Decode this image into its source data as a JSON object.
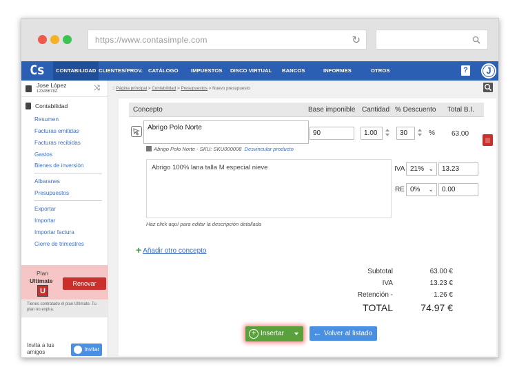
{
  "browser": {
    "url": "https://www.contasimple.com"
  },
  "nav": {
    "logo": "Cs",
    "items": [
      "CONTABILIDAD",
      "CLIENTES/PROV.",
      "CATÁLOGO",
      "IMPUESTOS",
      "DISCO VIRTUAL",
      "BANCOS",
      "INFORMES",
      "OTROS"
    ],
    "help": "?",
    "avatar": "J"
  },
  "user": {
    "name": "Jose López",
    "id": "12345678Z"
  },
  "sidebar": {
    "section": "Contabilidad",
    "group1": [
      "Resumen",
      "Facturas emitidas",
      "Facturas recibidas",
      "Gastos",
      "Bienes de inversión"
    ],
    "group2": [
      "Albaranes",
      "Presupuestos"
    ],
    "group3": [
      "Exportar",
      "Importar",
      "Importar factura",
      "Cierre de trimestres"
    ],
    "plan_label": "Plan",
    "plan_name": "Ultimate",
    "plan_badge": "U",
    "renew": "Renovar",
    "plan_note": "Tienes contratado el plan Ultimate. Tu plan no expira.",
    "invite_text": "Invita a tus amigos",
    "invite_button": "Invitar"
  },
  "breadcrumb": {
    "prefix": ":: ",
    "home": "Página principal",
    "sep": " > ",
    "accounting": "Contabilidad",
    "budgets": "Presupuestos",
    "current": "Nuevo presupuesto"
  },
  "table": {
    "headers": {
      "concept": "Concepto",
      "base": "Base imponible",
      "qty": "Cantidad",
      "discount": "% Descuento",
      "total": "Total B.I."
    }
  },
  "line": {
    "concept": "Abrigo Polo Norte",
    "product_info": "Abrigo Polo Norte - SKU: SKU000008",
    "unlink": "Desvincular producto",
    "base": "90",
    "qty": "1.00",
    "discount": "30",
    "pct_sign": "%",
    "total": "63.00",
    "description": "Abrigo 100% lana talla M especial nieve",
    "description_hint": "Haz click aquí para editar la descripción detallada",
    "iva_label": "IVA",
    "iva_rate": "21%",
    "iva_amount": "13.23",
    "re_label": "RE",
    "re_rate": "0%",
    "re_amount": "0.00"
  },
  "add_concept": "Añadir otro concepto",
  "totals": {
    "subtotal_label": "Subtotal",
    "subtotal": "63.00 €",
    "iva_label": "IVA",
    "iva": "13.23 €",
    "retention_label": "Retención -",
    "retention": "1.26 €",
    "total_label": "TOTAL",
    "total": "74.97 €"
  },
  "actions": {
    "insert": "Insertar",
    "insert_icon": "+",
    "back": "Volver al listado",
    "back_icon": "←"
  },
  "colors": {
    "nav": "#2b5fb3",
    "accent_link": "#3a6fc4",
    "insert": "#5aa13c",
    "back": "#4a90e2",
    "danger": "#c9302c"
  }
}
